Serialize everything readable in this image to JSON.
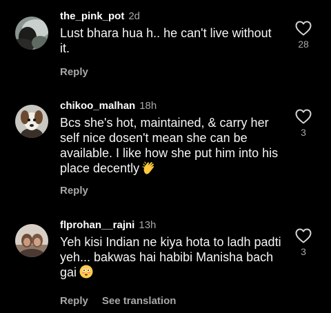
{
  "comments": [
    {
      "username": "the_pink_pot",
      "time": "2d",
      "text": "Lust bhara hua h.. he can't live without it.",
      "likes": "28",
      "reply_label": "Reply"
    },
    {
      "username": "chikoo_malhan",
      "time": "18h",
      "text": "Bcs she's hot, maintained, & carry her self nice dosen't mean she can be available. I like how she put him into his place decently",
      "emoji": "clapping-hands-emoji",
      "likes": "3",
      "reply_label": "Reply"
    },
    {
      "username": "flprohan__rajni",
      "time": "13h",
      "text": "Yeh kisi Indian ne kiya hota to ladh padti yeh... bakwas hai habibi Manisha bach gai",
      "emoji": "flushed-face-emoji",
      "likes": "3",
      "reply_label": "Reply",
      "translation_label": "See translation"
    }
  ],
  "colors": {
    "background": "#000000",
    "primary_text": "#ffffff",
    "secondary_text": "#a8a8a8"
  }
}
